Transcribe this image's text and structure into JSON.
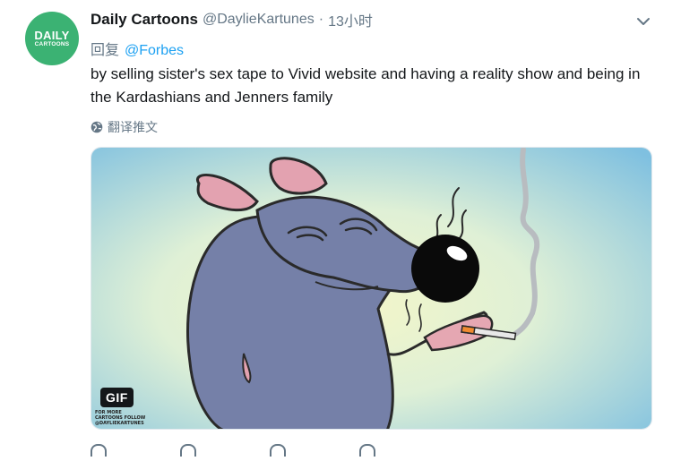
{
  "avatar": {
    "line1": "DAILY",
    "line2": "CARTOONS",
    "color": "#3bb273"
  },
  "tweet": {
    "name": "Daily Cartoons",
    "handle": "@DaylieKartunes",
    "separator": "·",
    "time": "13小时",
    "reply_prefix": "回复",
    "reply_mention": "@Forbes",
    "text": "by selling sister's sex tape to Vivid website and having a reality show and being in the Kardashians and Jenners family",
    "translate_label": "翻译推文"
  },
  "media": {
    "badge": "GIF",
    "credit": "FOR MORE CARTOONS FOLLOW @DAYLIEKARTUNES"
  },
  "icons": {
    "caret": "chevron-down-icon",
    "translate": "globe-icon",
    "actions": [
      "reply-icon",
      "retweet-icon",
      "like-icon",
      "message-icon"
    ]
  },
  "colors": {
    "link": "#1da1f2",
    "muted": "#657786",
    "text": "#14171a"
  }
}
